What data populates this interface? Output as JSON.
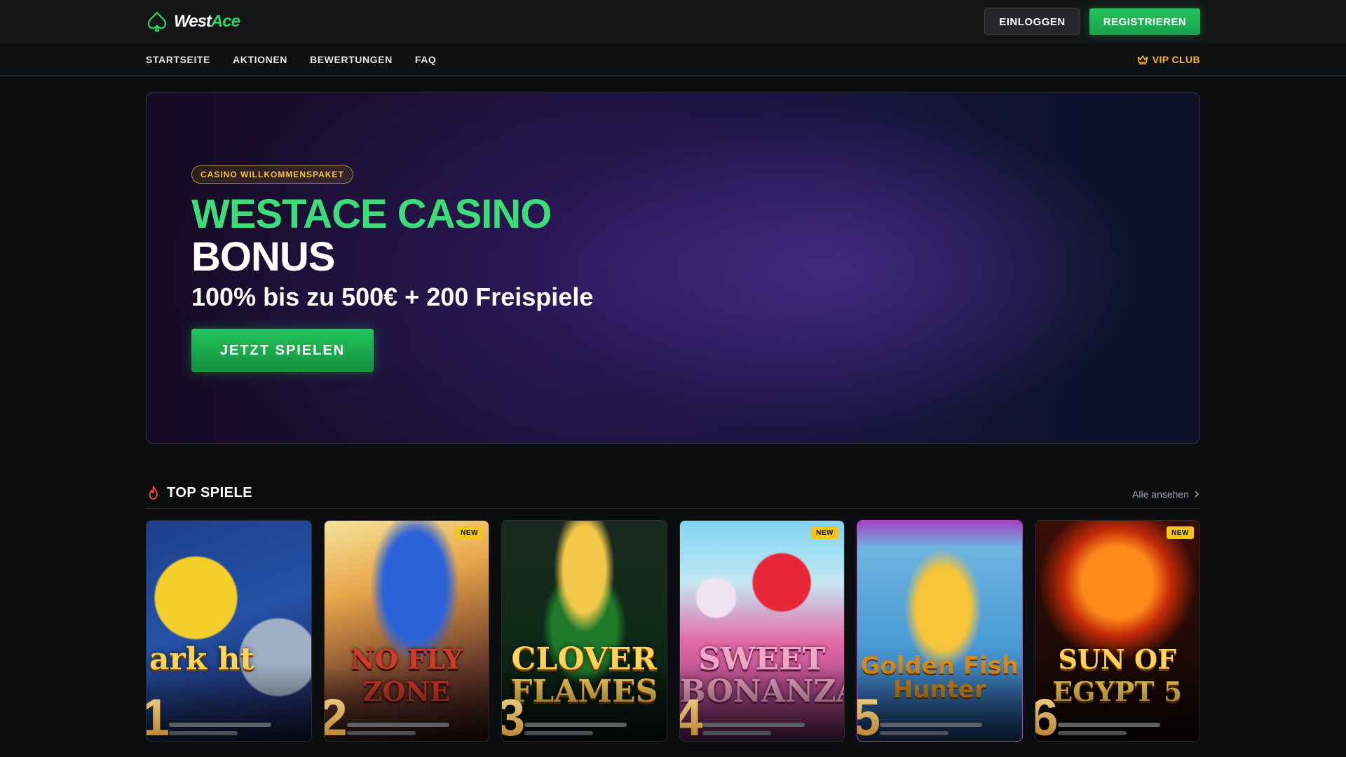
{
  "header": {
    "logo": {
      "part1": "West",
      "part2": "Ace",
      "icon": "spade-icon"
    },
    "login_label": "EINLOGGEN",
    "register_label": "REGISTRIEREN"
  },
  "nav": {
    "items": [
      {
        "label": "STARTSEITE"
      },
      {
        "label": "AKTIONEN"
      },
      {
        "label": "BEWERTUNGEN"
      },
      {
        "label": "FAQ"
      }
    ],
    "vip_label": "VIP CLUB",
    "vip_icon": "crown-icon"
  },
  "hero": {
    "badge": "CASINO WILLKOMMENSPAKET",
    "title_line1": "WESTACE CASINO",
    "title_line2": "BONUS",
    "subtitle": "100% bis zu 500€ + 200 Freispiele",
    "cta_label": "JETZT SPIELEN"
  },
  "top_games": {
    "title": "TOP SPIELE",
    "title_icon": "flame-icon",
    "see_all_label": "Alle ansehen",
    "new_label": "NEW",
    "games": [
      {
        "rank": "1",
        "name": "ark ht",
        "is_new": false
      },
      {
        "rank": "2",
        "name": "NO FLY ZONE",
        "is_new": true
      },
      {
        "rank": "3",
        "name": "CLOVER FLAMES",
        "is_new": false
      },
      {
        "rank": "4",
        "name": "SWEET BONANZA",
        "is_new": true
      },
      {
        "rank": "5",
        "name": "Golden Fish Hunter",
        "is_new": false
      },
      {
        "rank": "6",
        "name": "SUN OF EGYPT 5",
        "is_new": true
      }
    ]
  },
  "colors": {
    "accent_green": "#22c55e",
    "gold": "#f5b82e",
    "background": "#0c0d0f"
  }
}
